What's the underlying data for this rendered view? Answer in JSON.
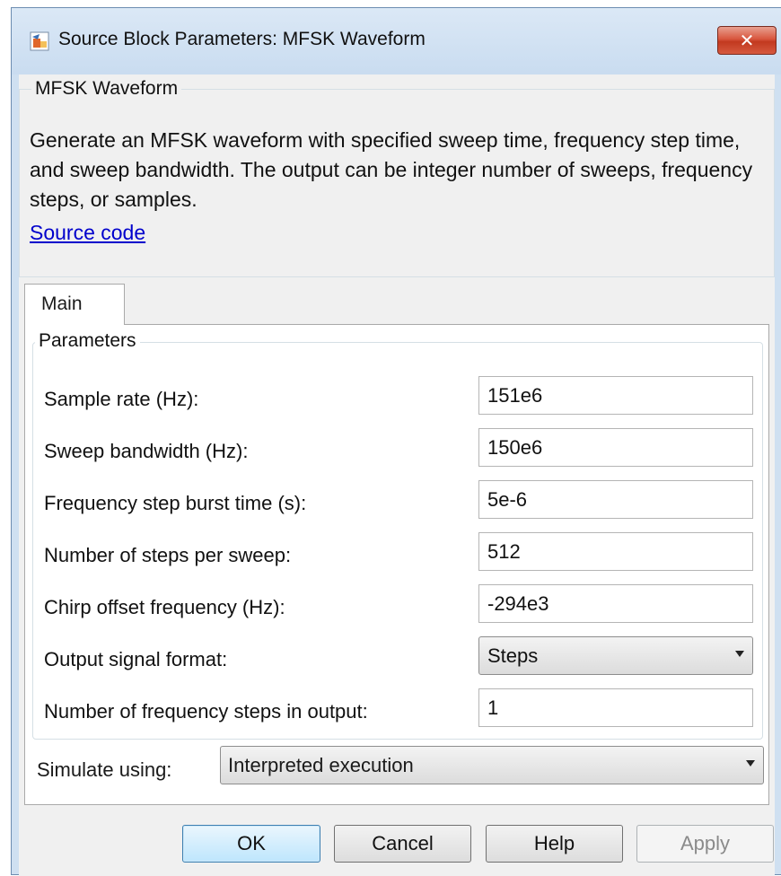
{
  "window": {
    "title": "Source Block Parameters: MFSK Waveform",
    "close_label": "✕"
  },
  "description": {
    "group_title": "MFSK Waveform",
    "text": "Generate an MFSK waveform with specified sweep time, frequency step time, and sweep bandwidth. The output can be integer number of sweeps, frequency steps, or samples.",
    "source_link": "Source code"
  },
  "tabs": [
    {
      "label": "Main"
    }
  ],
  "parameters": {
    "group_title": "Parameters",
    "fields": [
      {
        "label": "Sample rate (Hz):",
        "value": "151e6"
      },
      {
        "label": "Sweep bandwidth (Hz):",
        "value": "150e6"
      },
      {
        "label": "Frequency step burst time (s):",
        "value": "5e-6"
      },
      {
        "label": "Number of steps per sweep:",
        "value": "512"
      },
      {
        "label": "Chirp offset frequency (Hz):",
        "value": "-294e3"
      },
      {
        "label": "Output signal format:",
        "value": "Steps"
      },
      {
        "label": "Number of frequency steps in output:",
        "value": "1"
      }
    ]
  },
  "simulate": {
    "label": "Simulate using:",
    "value": "Interpreted execution"
  },
  "buttons": {
    "ok": "OK",
    "cancel": "Cancel",
    "help": "Help",
    "apply": "Apply"
  }
}
